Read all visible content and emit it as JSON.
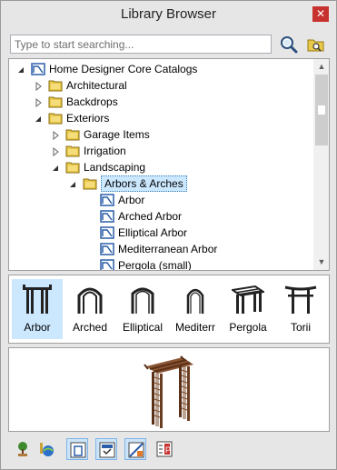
{
  "window": {
    "title": "Library Browser",
    "close_glyph": "✕"
  },
  "search": {
    "placeholder": "Type to start searching...",
    "search_icon": "magnifier-icon",
    "folder_search_icon": "folder-search-icon"
  },
  "tree": {
    "items": [
      {
        "label": "Home Designer Core Catalogs",
        "arrow": "expanded",
        "icon": "catalog-icon"
      },
      {
        "label": "Architectural",
        "arrow": "collapsed",
        "icon": "folder-icon"
      },
      {
        "label": "Backdrops",
        "arrow": "collapsed",
        "icon": "folder-icon"
      },
      {
        "label": "Exteriors",
        "arrow": "expanded",
        "icon": "folder-icon"
      },
      {
        "label": "Garage Items",
        "arrow": "collapsed",
        "icon": "folder-icon"
      },
      {
        "label": "Irrigation",
        "arrow": "collapsed",
        "icon": "folder-icon"
      },
      {
        "label": "Landscaping",
        "arrow": "expanded",
        "icon": "folder-icon"
      },
      {
        "label": "Arbors & Arches",
        "arrow": "expanded",
        "icon": "folder-icon",
        "selected": true
      },
      {
        "label": "Arbor",
        "arrow": "none",
        "icon": "object-icon"
      },
      {
        "label": "Arched Arbor",
        "arrow": "none",
        "icon": "object-icon"
      },
      {
        "label": "Elliptical Arbor",
        "arrow": "none",
        "icon": "object-icon"
      },
      {
        "label": "Mediterranean Arbor",
        "arrow": "none",
        "icon": "object-icon"
      },
      {
        "label": "Pergola (small)",
        "arrow": "none",
        "icon": "object-icon"
      }
    ]
  },
  "thumbnails": {
    "items": [
      {
        "label": "Arbor",
        "selected": true,
        "icon": "arbor-icon"
      },
      {
        "label": "Arched",
        "selected": false,
        "icon": "arched-arbor-icon"
      },
      {
        "label": "Elliptical",
        "selected": false,
        "icon": "elliptical-arbor-icon"
      },
      {
        "label": "Mediterr",
        "selected": false,
        "icon": "mediterranean-arbor-icon"
      },
      {
        "label": "Pergola",
        "selected": false,
        "icon": "pergola-icon"
      },
      {
        "label": "Torii",
        "selected": false,
        "icon": "torii-icon"
      }
    ]
  },
  "preview": {
    "icon": "arbor-3d-preview"
  },
  "toolbar": {
    "buttons": [
      {
        "icon": "plant-chooser-icon",
        "active": false
      },
      {
        "icon": "globe-options-icon",
        "active": false
      },
      {
        "icon": "show-objects-icon",
        "active": true
      },
      {
        "icon": "show-folders-icon",
        "active": true
      },
      {
        "icon": "show-materials-icon",
        "active": true
      },
      {
        "icon": "properties-icon",
        "active": false
      }
    ]
  },
  "colors": {
    "selection_bg": "#cce8ff",
    "folder_yellow": "#e8c94a",
    "catalog_blue": "#2a5ea8",
    "close_red": "#c7322f",
    "arbor_brown": "#6b3e22"
  }
}
